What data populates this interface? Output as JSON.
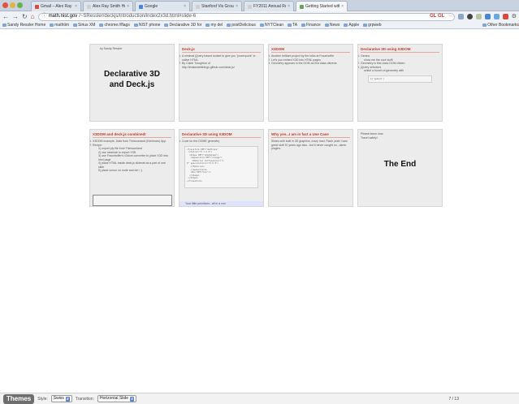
{
  "tabs": [
    {
      "label": "Gmail – Alex Ray Smith Hom",
      "color": "#d84b3a",
      "active": false
    },
    {
      "label": "Alex Ray Smith Homepage",
      "color": "#cfcfcf",
      "active": false
    },
    {
      "label": "Google",
      "color": "#4a84d6",
      "active": false
    },
    {
      "label": "Stanford Vis Group | Protov",
      "color": "#cfcfcf",
      "active": false
    },
    {
      "label": "FY2011 Annual Report Write",
      "color": "#cfcfcf",
      "active": false
    },
    {
      "label": "Getting Started with deck.js",
      "color": "#6aa05a",
      "active": true
    }
  ],
  "omnibox": {
    "domain": "math.nist.gov",
    "path": "/~SRessler/deckjs/introduction/index2x3d.html#slide-6"
  },
  "bookmarks": [
    "Sandy Ressler Home",
    "mathtim",
    "Sirius XM",
    "chrome://flags",
    "NIST phone",
    "Declarative 3D for",
    "my del",
    "postDelicious",
    "NYTClean",
    "TA",
    "Finance",
    "News",
    "Apple",
    "grpweb",
    "Other Bookmarks"
  ],
  "slides": [
    {
      "type": "title",
      "byline": "by Sandy Ressler",
      "title": "Declarative 3D and Deck.js"
    },
    {
      "type": "list",
      "heading": "Deck.js",
      "items": [
        "A minimal jQuery based toolset to give you \"powerpoint\" in native HTML.",
        "By Caleb Troughton of http://imakewebthings.github.com/deck.js/"
      ]
    },
    {
      "type": "list",
      "heading": "X3DOM",
      "items": [
        "Another brilliant project by the folks at Fraunhoffer",
        "Let's you embed X3D into HTML pages",
        "Geometry appears in the DOM as first class citizens"
      ]
    },
    {
      "type": "code",
      "heading": "Declarative 3D using X3DOM",
      "items": [
        "Genius",
        "Geometry is first class DOM citizen",
        "jQuery selectors"
      ],
      "subitems": [
        "show me the cool stuff!",
        "select a bunch of geometry with"
      ],
      "code": "$('sphere')"
    },
    {
      "type": "list",
      "heading": "X3DOM and deck.js combined!",
      "items": [
        "X3DOM example, Data from Thimoonland (Kimimaru) App.",
        "Recipe:"
      ],
      "steps": [
        "1) export ply file from Thimoonland",
        "2) use meshlab to export X3D",
        "3) use Fraunhoffer's x3dom converter to place X3D into html page",
        "4) place HTML inside deck.js slideset as a part of one slide",
        "5) place cursor on node and ctrl / ;)"
      ]
    },
    {
      "type": "code",
      "heading": "Declarative 3D using X3DOM",
      "items": [
        "Code for the DOME geometry"
      ],
      "code": "<Transform DEF=\"dadTrans\"\n rotation=\"0 1 0 0\">\n  <Shape DEF=\"domeShape\">\n   <Appearance DEF=\"orange\">\n    <Material diffuseColor=\"1\n0\" specularColor=\"0 0 0\">\n   </Material>\n   </Appearance>\n   <Box DEF=\"box\"/>\n  </Shape>\n </Shape>\n</Transform>",
      "footnote": "Your little primitives...all in a row"
    },
    {
      "type": "list",
      "heading": "Why yes...I am in fact a Use Case",
      "paragraph": "Slides with built in 3D graphics, crazy mad. Flash yeah I saw great stuff 10 years ago also...but it never caught on...damn plugins."
    },
    {
      "type": "end",
      "note": "Please leave now. Travel safely!",
      "title": "The End"
    }
  ],
  "footer": {
    "themes_label": "Themes",
    "style_label": "Style:",
    "style_value": "Swiss",
    "transition_label": "Transition:",
    "transition_value": "Horizontal Slide",
    "counter": "7 / 13"
  }
}
